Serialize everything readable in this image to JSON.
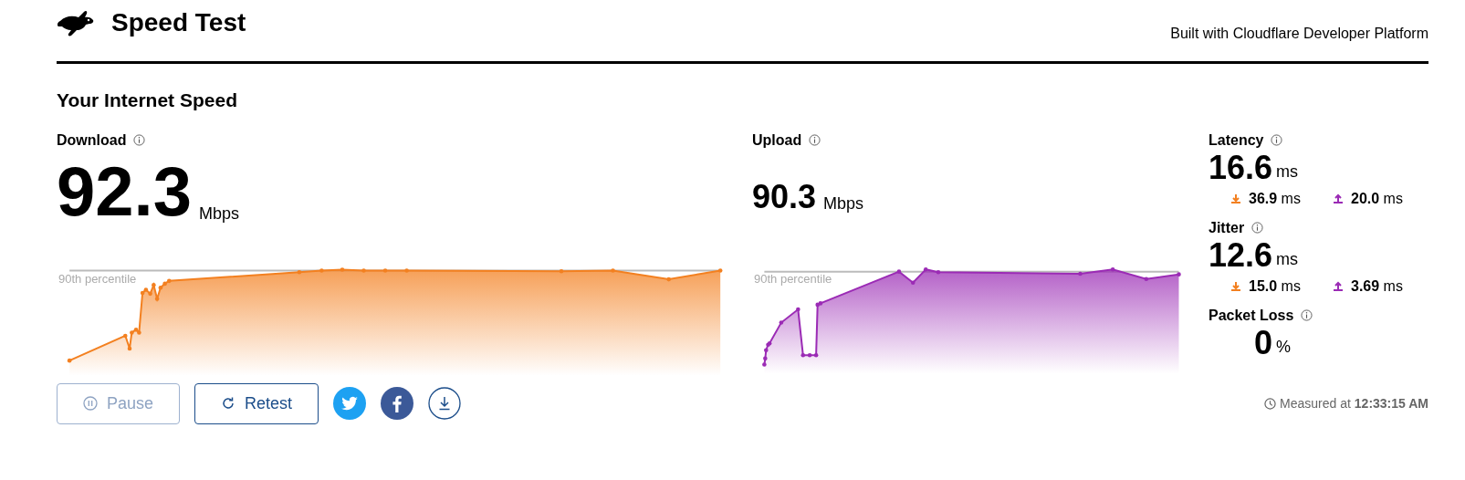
{
  "header": {
    "title": "Speed Test",
    "tagline": "Built with Cloudflare Developer Platform"
  },
  "heading": "Your Internet Speed",
  "download": {
    "label": "Download",
    "value": "92.3",
    "unit": "Mbps",
    "percentile_label": "90th percentile"
  },
  "upload": {
    "label": "Upload",
    "value": "90.3",
    "unit": "Mbps",
    "percentile_label": "90th percentile"
  },
  "metrics": [
    {
      "label": "Latency",
      "value": "16.6",
      "unit": "ms",
      "down": "36.9",
      "down_unit": "ms",
      "up": "20.0",
      "up_unit": "ms"
    },
    {
      "label": "Jitter",
      "value": "12.6",
      "unit": "ms",
      "down": "15.0",
      "down_unit": "ms",
      "up": "3.69",
      "up_unit": "ms"
    },
    {
      "label": "Packet Loss",
      "value": "0",
      "unit": "%"
    }
  ],
  "buttons": [
    {
      "kind": "pause",
      "label": "Pause",
      "disabled": true
    },
    {
      "kind": "retest",
      "label": "Retest",
      "disabled": false
    }
  ],
  "measured": {
    "label": "Measured at",
    "time": "12:33:15 AM"
  }
}
